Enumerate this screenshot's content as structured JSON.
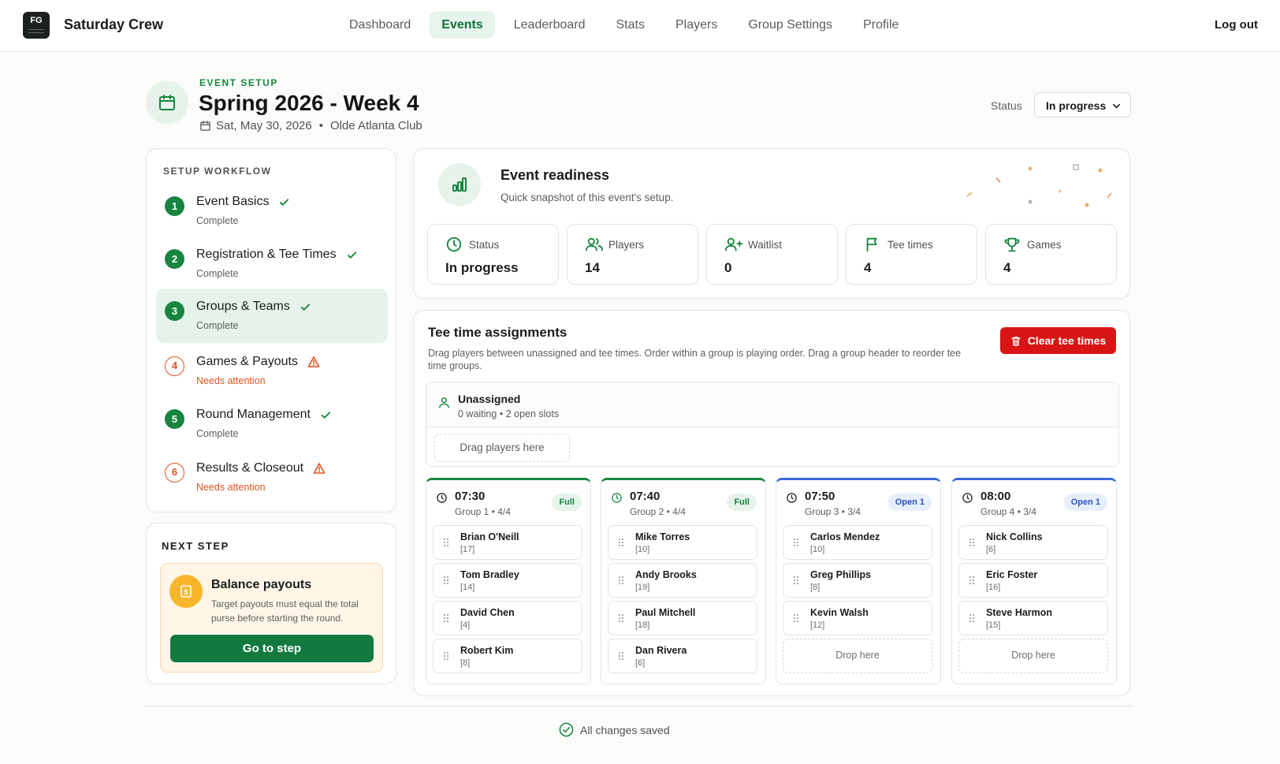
{
  "app": {
    "brand": "Saturday Crew",
    "logo_text": "FG"
  },
  "nav": {
    "items": [
      {
        "label": "Dashboard"
      },
      {
        "label": "Events"
      },
      {
        "label": "Leaderboard"
      },
      {
        "label": "Stats"
      },
      {
        "label": "Players"
      },
      {
        "label": "Group Settings"
      },
      {
        "label": "Profile"
      }
    ],
    "active": "Events",
    "logout": "Log out"
  },
  "header": {
    "eyebrow": "EVENT SETUP",
    "title": "Spring 2026 - Week 4",
    "date": "Sat, May 30, 2026",
    "separator": "•",
    "course": "Olde Atlanta Club",
    "status_label": "Status",
    "status_value": "In progress",
    "icon": "calendar-icon"
  },
  "workflow": {
    "title": "SETUP WORKFLOW",
    "steps": [
      {
        "num": "1",
        "name": "Event Basics",
        "state": "Complete",
        "done": true
      },
      {
        "num": "2",
        "name": "Registration & Tee Times",
        "state": "Complete",
        "done": true
      },
      {
        "num": "3",
        "name": "Groups & Teams",
        "state": "Complete",
        "done": true
      },
      {
        "num": "4",
        "name": "Games & Payouts",
        "state": "Needs attention",
        "done": false
      },
      {
        "num": "5",
        "name": "Round Management",
        "state": "Complete",
        "done": true
      },
      {
        "num": "6",
        "name": "Results & Closeout",
        "state": "Needs attention",
        "done": false
      }
    ],
    "active_step": "3"
  },
  "next_step": {
    "title": "NEXT STEP",
    "heading": "Balance payouts",
    "description": "Target payouts must equal the total purse before starting the round.",
    "button": "Go to step",
    "icon": "dollar-icon"
  },
  "readiness": {
    "title": "Event readiness",
    "subtitle": "Quick snapshot of this event's setup.",
    "tiles": [
      {
        "label": "Status",
        "value": "In progress",
        "icon": "clock-icon"
      },
      {
        "label": "Players",
        "value": "14",
        "icon": "users-icon"
      },
      {
        "label": "Waitlist",
        "value": "0",
        "icon": "user-plus-icon"
      },
      {
        "label": "Tee times",
        "value": "4",
        "icon": "flag-icon"
      },
      {
        "label": "Games",
        "value": "4",
        "icon": "trophy-icon"
      }
    ]
  },
  "tee_times": {
    "title": "Tee time assignments",
    "description": "Drag players between unassigned and tee times. Order within a group is playing order. Drag a group header to reorder tee time groups.",
    "clear_button": "Clear tee times",
    "unassigned": {
      "title": "Unassigned",
      "waiting": "0 waiting",
      "separator": "•",
      "open_slots": "2 open slots",
      "drop_label": "Drag players here"
    },
    "groups": [
      {
        "time": "07:30",
        "group": "Group 1",
        "sep": "•",
        "fill": "4/4",
        "badge": "Full",
        "type": "full",
        "players": [
          {
            "name": "Brian O'Neill",
            "hcp": "[17]"
          },
          {
            "name": "Tom Bradley",
            "hcp": "[14]"
          },
          {
            "name": "David Chen",
            "hcp": "[4]"
          },
          {
            "name": "Robert Kim",
            "hcp": "[8]"
          }
        ]
      },
      {
        "time": "07:40",
        "group": "Group 2",
        "sep": "•",
        "fill": "4/4",
        "badge": "Full",
        "type": "full",
        "players": [
          {
            "name": "Mike Torres",
            "hcp": "[10]"
          },
          {
            "name": "Andy Brooks",
            "hcp": "[19]"
          },
          {
            "name": "Paul Mitchell",
            "hcp": "[18]"
          },
          {
            "name": "Dan Rivera",
            "hcp": "[6]"
          }
        ]
      },
      {
        "time": "07:50",
        "group": "Group 3",
        "sep": "•",
        "fill": "3/4",
        "badge": "Open 1",
        "type": "open",
        "players": [
          {
            "name": "Carlos Mendez",
            "hcp": "[10]"
          },
          {
            "name": "Greg Phillips",
            "hcp": "[8]"
          },
          {
            "name": "Kevin Walsh",
            "hcp": "[12]"
          }
        ]
      },
      {
        "time": "08:00",
        "group": "Group 4",
        "sep": "•",
        "fill": "3/4",
        "badge": "Open 1",
        "type": "open",
        "players": [
          {
            "name": "Nick Collins",
            "hcp": "[6]"
          },
          {
            "name": "Eric Foster",
            "hcp": "[16]"
          },
          {
            "name": "Steve Harmon",
            "hcp": "[15]"
          }
        ]
      }
    ],
    "drop_label": "Drop here"
  },
  "footer": {
    "saved": "All changes saved"
  },
  "colors": {
    "brand_green": "#17853f",
    "warn_orange": "#e0531f",
    "danger_red": "#d91414",
    "open_blue": "#3a66d9"
  }
}
